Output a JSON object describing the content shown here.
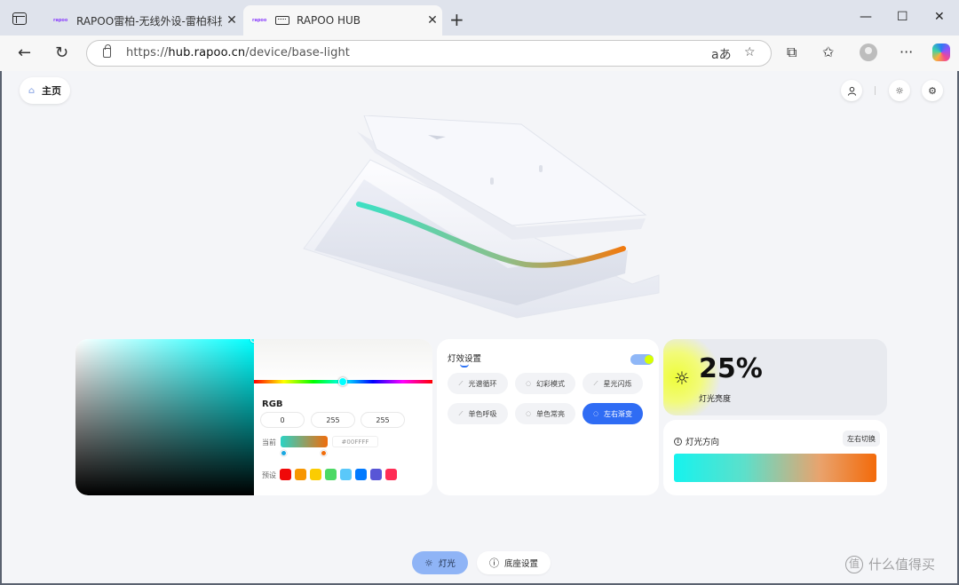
{
  "browser": {
    "tabs": [
      {
        "title": "RAPOO雷柏-无线外设-雷柏科技",
        "favicon": "rapoo",
        "active": false
      },
      {
        "title": "RAPOO HUB",
        "active": true
      }
    ],
    "url_scheme": "https://",
    "url_host": "hub.rapoo.cn",
    "url_path": "/device/base-light",
    "icons": {
      "tab_strip": "tab-strip-icon",
      "back": "←",
      "reload": "↻",
      "read_aloud": "aあ",
      "favorite": "☆",
      "split": "split-screen-icon",
      "favorites": "favorites-icon",
      "more": "···",
      "minimize": "—",
      "maximize": "☐",
      "close": "✕"
    }
  },
  "header": {
    "home_label": "主页",
    "icons": {
      "home": "⌂",
      "user": "user-icon",
      "theme": "☼",
      "settings": "⚙"
    }
  },
  "picker": {
    "rgb_label": "RGB",
    "r": "0",
    "g": "255",
    "b": "255",
    "current_label": "当前",
    "hex": "#00FFFF",
    "preset_label": "预设",
    "current_gradient_from": "#2bd3c4",
    "current_gradient_to": "#f06d0c",
    "presets": [
      "#f00909",
      "#f79600",
      "#fbcc02",
      "#4cd964",
      "#5ac8fa",
      "#007aff",
      "#5856d6",
      "#ff2d55"
    ]
  },
  "effects": {
    "title": "灯效设置",
    "enabled": true,
    "modes": [
      {
        "label": "光谱循环",
        "icon": "⟋"
      },
      {
        "label": "幻彩模式",
        "icon": "◌"
      },
      {
        "label": "星光闪烁",
        "icon": "⟋"
      },
      {
        "label": "单色呼吸",
        "icon": "⟋"
      },
      {
        "label": "单色常亮",
        "icon": "◌"
      },
      {
        "label": "左右渐变",
        "icon": "◌",
        "active": true
      }
    ]
  },
  "brightness": {
    "value_text": "25%",
    "value": 25,
    "label": "灯光亮度",
    "icon": "☼"
  },
  "direction": {
    "title": "灯光方向",
    "switch_label": "左右切换",
    "gradient_from": "#16f3ee",
    "gradient_to": "#f36a0a"
  },
  "bottom_tabs": {
    "light_label": "灯光",
    "base_label": "底座设置",
    "light_icon": "☼",
    "base_icon": "ⓘ"
  },
  "watermark": {
    "text": "什么值得买",
    "icon": "值"
  }
}
